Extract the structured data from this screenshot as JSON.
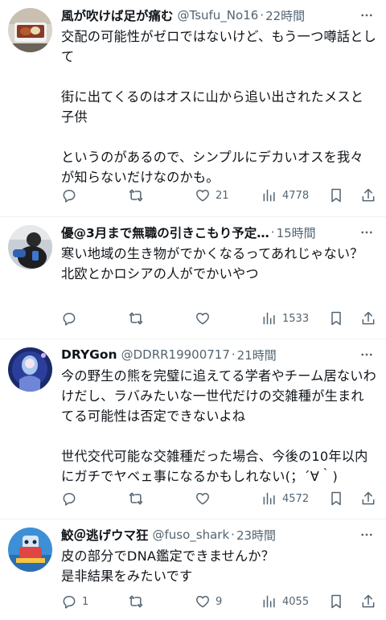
{
  "tweets": [
    {
      "name": "風が吹けば足が痛む",
      "handle": "@Tsufu_No16",
      "dot": "·",
      "time": "22時間",
      "text": "交配の可能性がゼロではないけど、もう一つ噂話として\n\n街に出てくるのはオスに山から追い出されたメスと子供\n\nというのがあるので、シンプルにデカいオスを我々が知らないだけなのかも。",
      "reply_count": "",
      "retweet_count": "",
      "like_count": "21",
      "view_count": "4778"
    },
    {
      "name": "優@3月まで無職の引きこもり予定…",
      "handle": "",
      "dot": "·",
      "time": "15時間",
      "text": "寒い地域の生き物がでかくなるってあれじゃない？\n北欧とかロシアの人がでかいやつ",
      "reply_count": "",
      "retweet_count": "",
      "like_count": "",
      "view_count": "1533"
    },
    {
      "name": "DRYGon",
      "handle": "@DDRR19900717",
      "dot": "·",
      "time": "21時間",
      "text": "今の野生の熊を完璧に追えてる学者やチーム居ないわけだし、ラバみたいな一世代だけの交雑種が生まれてる可能性は否定できないよね\n\n世代交代可能な交雑種だった場合、今後の10年以内にガチでヤベェ事になるかもしれない(；´∀｀)",
      "reply_count": "",
      "retweet_count": "",
      "like_count": "",
      "view_count": "4572"
    },
    {
      "name": "鮫＠逃げウマ狂",
      "handle": "@fuso_shark",
      "dot": "·",
      "time": "23時間",
      "text": "皮の部分でDNA鑑定できませんか？\n是非結果をみたいです",
      "reply_count": "1",
      "retweet_count": "",
      "like_count": "9",
      "view_count": "4055"
    }
  ],
  "icons": {
    "more": "more-icon",
    "reply": "reply-icon",
    "retweet": "retweet-icon",
    "like": "heart-icon",
    "views": "views-icon",
    "bookmark": "bookmark-icon",
    "share": "share-icon"
  },
  "colors": {
    "text": "#0f1419",
    "secondary": "#536471",
    "divider": "#eff3f4"
  }
}
